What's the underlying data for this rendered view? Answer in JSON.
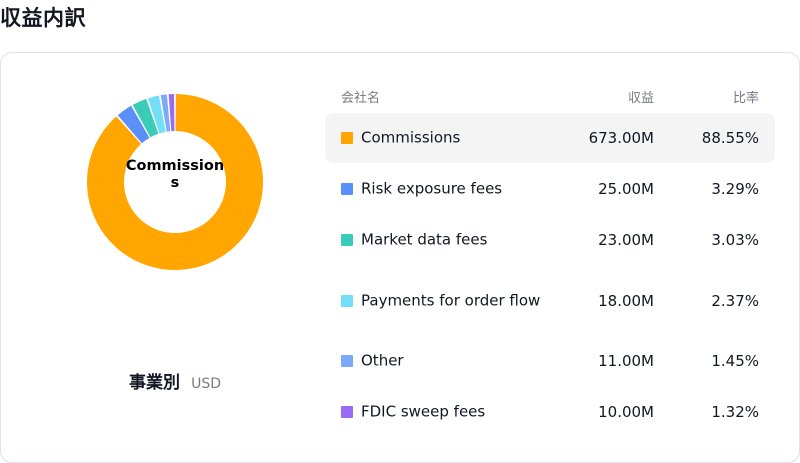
{
  "page": {
    "title": "収益内訳"
  },
  "chart": {
    "center_label": "Commissions",
    "caption_title": "事業別",
    "caption_currency": "USD"
  },
  "table": {
    "headers": {
      "name": "会社名",
      "revenue": "収益",
      "ratio": "比率"
    }
  },
  "chart_data": {
    "type": "pie",
    "style": "donut",
    "categories": [
      "Commissions",
      "Risk exposure fees",
      "Market data fees",
      "Payments for order flow",
      "Other",
      "FDIC sweep fees"
    ],
    "values": [
      673.0,
      25.0,
      23.0,
      18.0,
      11.0,
      10.0
    ],
    "unit": "M USD",
    "revenue_labels": [
      "673.00M",
      "25.00M",
      "23.00M",
      "18.00M",
      "11.00M",
      "10.00M"
    ],
    "percent_labels": [
      "88.55%",
      "3.29%",
      "3.03%",
      "2.37%",
      "1.45%",
      "1.32%"
    ],
    "colors": [
      "#ffa600",
      "#5b8ff9",
      "#3bcbb9",
      "#73def6",
      "#7aaaf8",
      "#9a6cf4"
    ],
    "highlighted": "Commissions"
  }
}
